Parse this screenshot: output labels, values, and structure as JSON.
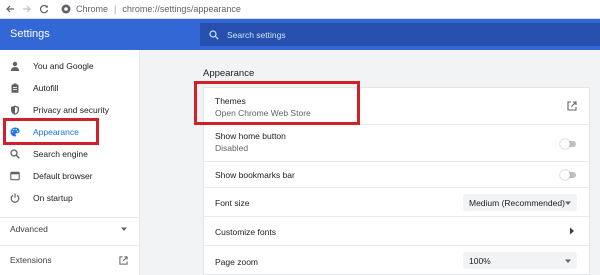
{
  "browser": {
    "site_label": "Chrome",
    "url": "chrome://settings/appearance"
  },
  "header": {
    "title": "Settings",
    "search_placeholder": "Search settings"
  },
  "sidebar": {
    "items": [
      {
        "label": "You and Google",
        "icon": "person-icon"
      },
      {
        "label": "Autofill",
        "icon": "clipboard-icon"
      },
      {
        "label": "Privacy and security",
        "icon": "shield-icon"
      },
      {
        "label": "Appearance",
        "icon": "palette-icon",
        "active": true
      },
      {
        "label": "Search engine",
        "icon": "search-icon"
      },
      {
        "label": "Default browser",
        "icon": "browser-window-icon"
      },
      {
        "label": "On startup",
        "icon": "power-icon"
      }
    ],
    "advanced": "Advanced",
    "extensions": "Extensions"
  },
  "main": {
    "section_title": "Appearance",
    "themes": {
      "title": "Themes",
      "subtitle": "Open Chrome Web Store"
    },
    "home_button": {
      "title": "Show home button",
      "subtitle": "Disabled",
      "enabled": false
    },
    "bookmarks_bar": {
      "title": "Show bookmarks bar",
      "enabled": false
    },
    "font_size": {
      "title": "Font size",
      "value": "Medium (Recommended)"
    },
    "customize_fonts": {
      "title": "Customize fonts"
    },
    "page_zoom": {
      "title": "Page zoom",
      "value": "100%"
    }
  },
  "colors": {
    "header_blue": "#3367d6",
    "search_blue": "#274fae",
    "active_blue": "#1a73e8",
    "highlight_red": "#d0202a"
  }
}
